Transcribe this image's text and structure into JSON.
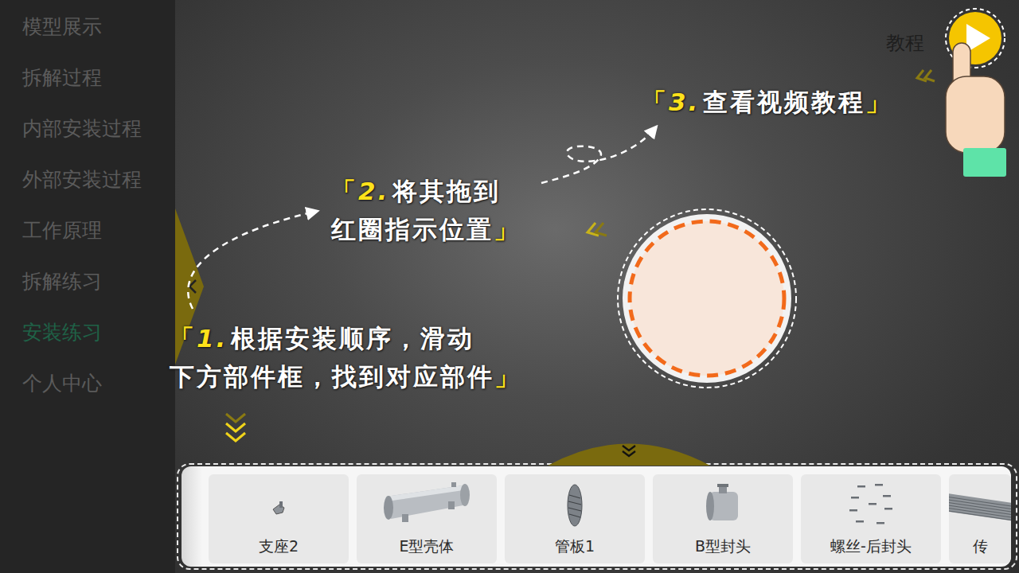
{
  "sidebar": {
    "items": [
      {
        "label": "模型展示",
        "selected": false
      },
      {
        "label": "拆解过程",
        "selected": false
      },
      {
        "label": "内部安装过程",
        "selected": false
      },
      {
        "label": "外部安装过程",
        "selected": false
      },
      {
        "label": "工作原理",
        "selected": false
      },
      {
        "label": "拆解练习",
        "selected": false
      },
      {
        "label": "安装练习",
        "selected": true
      },
      {
        "label": "个人中心",
        "selected": false
      }
    ]
  },
  "tutorial": {
    "label": "教程",
    "steps": [
      {
        "open": "「",
        "number": "1.",
        "lines": [
          "根据安装顺序，滑动",
          "下方部件框，找到对应部件"
        ],
        "close": "」"
      },
      {
        "open": "「",
        "number": "2.",
        "lines": [
          "将其拖到",
          "红圈指示位置"
        ],
        "close": "」"
      },
      {
        "open": "「",
        "number": "3.",
        "lines": [
          "查看视频教程"
        ],
        "close": "」"
      }
    ]
  },
  "parts": [
    {
      "label": "支座2",
      "kind": "bracket"
    },
    {
      "label": "E型壳体",
      "kind": "shell"
    },
    {
      "label": "管板1",
      "kind": "plate"
    },
    {
      "label": "B型封头",
      "kind": "head"
    },
    {
      "label": "螺丝-后封头",
      "kind": "screws"
    },
    {
      "label": "传",
      "kind": "tubes"
    }
  ]
}
